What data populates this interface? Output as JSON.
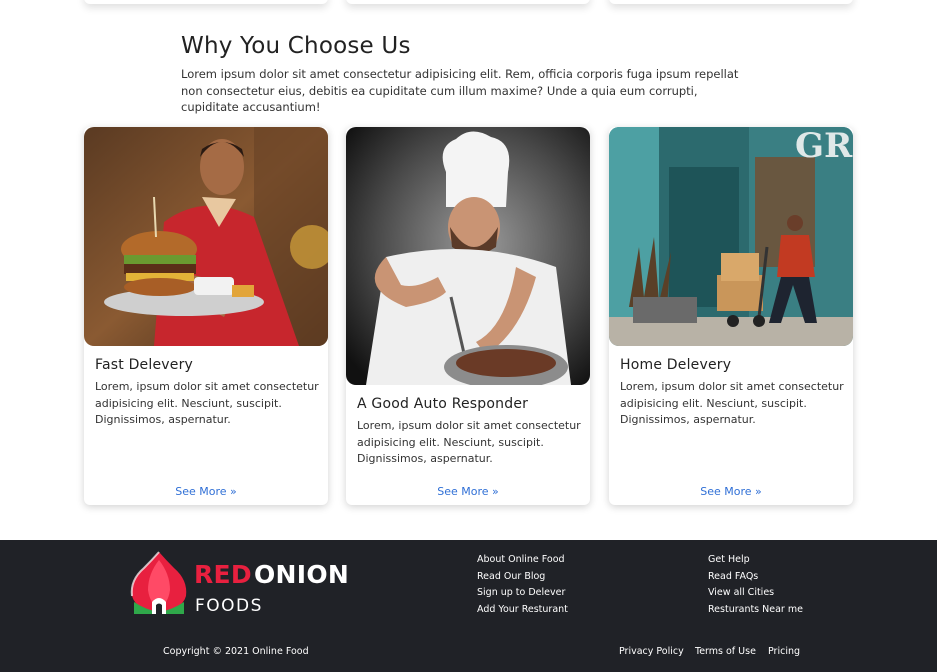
{
  "section": {
    "title": "Why You Choose Us",
    "description": "Lorem ipsum dolor sit amet consectetur adipisicing elit. Rem, officia corporis fuga ipsum repellat non consectetur eius, debitis ea cupiditate cum illum maxime? Unde a quia eum corrupti, cupiditate accusantium!"
  },
  "cards": [
    {
      "title": "Fast Delevery",
      "text": "Lorem, ipsum dolor sit amet consectetur adipisicing elit. Nesciunt, suscipit. Dignissimos, aspernatur.",
      "link": "See More »",
      "image": "waiter-holding-burger-photo"
    },
    {
      "title": "A Good Auto Responder",
      "text": "Lorem, ipsum dolor sit amet consectetur adipisicing elit. Nesciunt, suscipit. Dignissimos, aspernatur.",
      "link": "See More »",
      "image": "chef-cooking-photo"
    },
    {
      "title": "Home Delevery",
      "text": "Lorem, ipsum dolor sit amet consectetur adipisicing elit. Nesciunt, suscipit. Dignissimos, aspernatur.",
      "link": "See More »",
      "image": "delivery-man-with-boxes-photo"
    }
  ],
  "footer": {
    "brand": {
      "red": "RED",
      "white": "ONION",
      "sub": "FOODS",
      "logo_icon": "onion-icon"
    },
    "col1": [
      "About Online Food",
      "Read Our Blog",
      "Sign up to Delever",
      "Add Your Resturant"
    ],
    "col2": [
      "Get Help",
      "Read FAQs",
      "View all Cities",
      "Resturants Near me"
    ],
    "copyright": "Copyright © 2021 Online Food",
    "bottom_links": [
      "Privacy Policy",
      "Terms of Use",
      "Pricing"
    ]
  },
  "colors": {
    "accent": "#e8203f",
    "link": "#2f6fd6",
    "footer_bg": "#202227"
  }
}
